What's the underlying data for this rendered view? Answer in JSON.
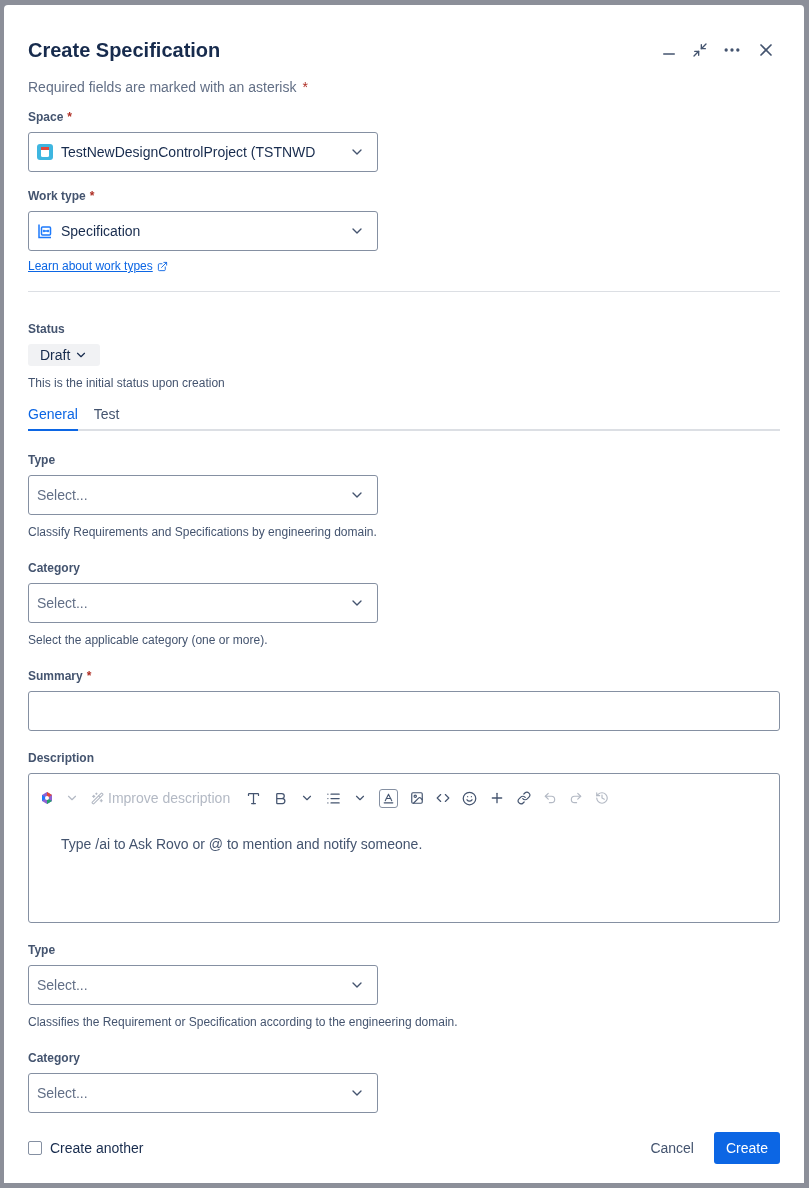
{
  "dialog": {
    "title": "Create Specification",
    "required_note": "Required fields are marked with an asterisk",
    "required_mark": "*"
  },
  "top_fields": [
    {
      "kind": "select",
      "label": "Space",
      "required": true,
      "value": "TestNewDesignControlProject (TSTNWD"
    },
    {
      "kind": "select",
      "label": "Work type",
      "required": true,
      "value": "Specification",
      "link": "Learn about work types"
    }
  ],
  "status": {
    "label": "Status",
    "value": "Draft",
    "help": "This is the initial status upon creation"
  },
  "tabs": [
    {
      "label": "General",
      "selected": true
    },
    {
      "label": "Test",
      "selected": false
    }
  ],
  "fields": [
    {
      "kind": "select",
      "label": "Type",
      "placeholder": "Select...",
      "help": "Classify Requirements and Specifications by engineering domain."
    },
    {
      "kind": "select",
      "label": "Category",
      "placeholder": "Select...",
      "help": "Select the applicable category (one or more)."
    },
    {
      "kind": "text",
      "label": "Summary",
      "required": true
    },
    {
      "kind": "editor",
      "label": "Description",
      "toolbar_action": "Improve description",
      "placeholder": "Type /ai to Ask Rovo or @ to mention and notify someone."
    },
    {
      "kind": "select",
      "label": "Type",
      "placeholder": "Select...",
      "help": "Classifies the Requirement or Specification according to the engineering domain."
    },
    {
      "kind": "select",
      "label": "Category",
      "placeholder": "Select..."
    }
  ],
  "footer": {
    "create_another": {
      "label": "Create another",
      "checked": false
    },
    "buttons": [
      {
        "label": "Cancel",
        "kind": "secondary"
      },
      {
        "label": "Create",
        "kind": "primary"
      }
    ]
  }
}
